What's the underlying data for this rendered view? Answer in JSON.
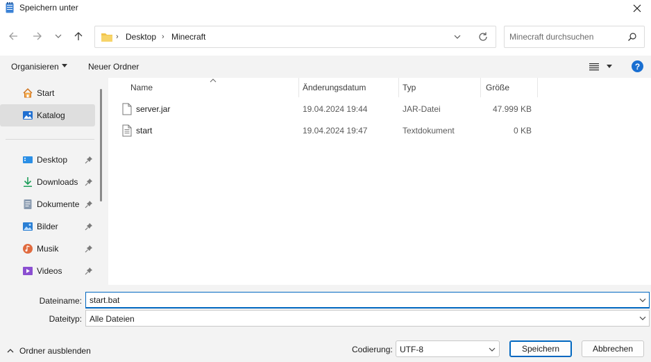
{
  "window": {
    "title": "Speichern unter"
  },
  "address": {
    "crumbs": [
      "Desktop",
      "Minecraft"
    ],
    "separator": "›"
  },
  "search": {
    "placeholder": "Minecraft durchsuchen"
  },
  "toolbar": {
    "organize_label": "Organisieren",
    "new_folder_label": "Neuer Ordner",
    "help_label": "?"
  },
  "sidebar": {
    "items": [
      {
        "label": "Start",
        "icon": "home-icon",
        "selected": false,
        "pinned": false
      },
      {
        "label": "Katalog",
        "icon": "gallery-icon",
        "selected": true,
        "pinned": false
      },
      {
        "label": "Desktop",
        "icon": "desktop-icon",
        "selected": false,
        "pinned": true
      },
      {
        "label": "Downloads",
        "icon": "download-icon",
        "selected": false,
        "pinned": true
      },
      {
        "label": "Dokumente",
        "icon": "documents-icon",
        "selected": false,
        "pinned": true
      },
      {
        "label": "Bilder",
        "icon": "pictures-icon",
        "selected": false,
        "pinned": true
      },
      {
        "label": "Musik",
        "icon": "music-icon",
        "selected": false,
        "pinned": true
      },
      {
        "label": "Videos",
        "icon": "videos-icon",
        "selected": false,
        "pinned": true
      }
    ]
  },
  "filelist": {
    "columns": [
      "Name",
      "Änderungsdatum",
      "Typ",
      "Größe"
    ],
    "rows": [
      {
        "name": "server.jar",
        "date": "19.04.2024 19:44",
        "type": "JAR-Datei",
        "size": "47.999 KB",
        "icon": "file-icon"
      },
      {
        "name": "start",
        "date": "19.04.2024 19:47",
        "type": "Textdokument",
        "size": "0 KB",
        "icon": "text-file-icon"
      }
    ]
  },
  "form": {
    "filename_label": "Dateiname:",
    "filename_value": "start.bat",
    "filetype_label": "Dateityp:",
    "filetype_value": "Alle Dateien",
    "hide_folders_label": "Ordner ausblenden",
    "encoding_label": "Codierung:",
    "encoding_value": "UTF-8",
    "save_label": "Speichern",
    "cancel_label": "Abbrechen"
  },
  "colors": {
    "accent": "#0067c0",
    "help": "#1a6fd1",
    "folder": "#f2c44b",
    "selection": "#dedede"
  }
}
